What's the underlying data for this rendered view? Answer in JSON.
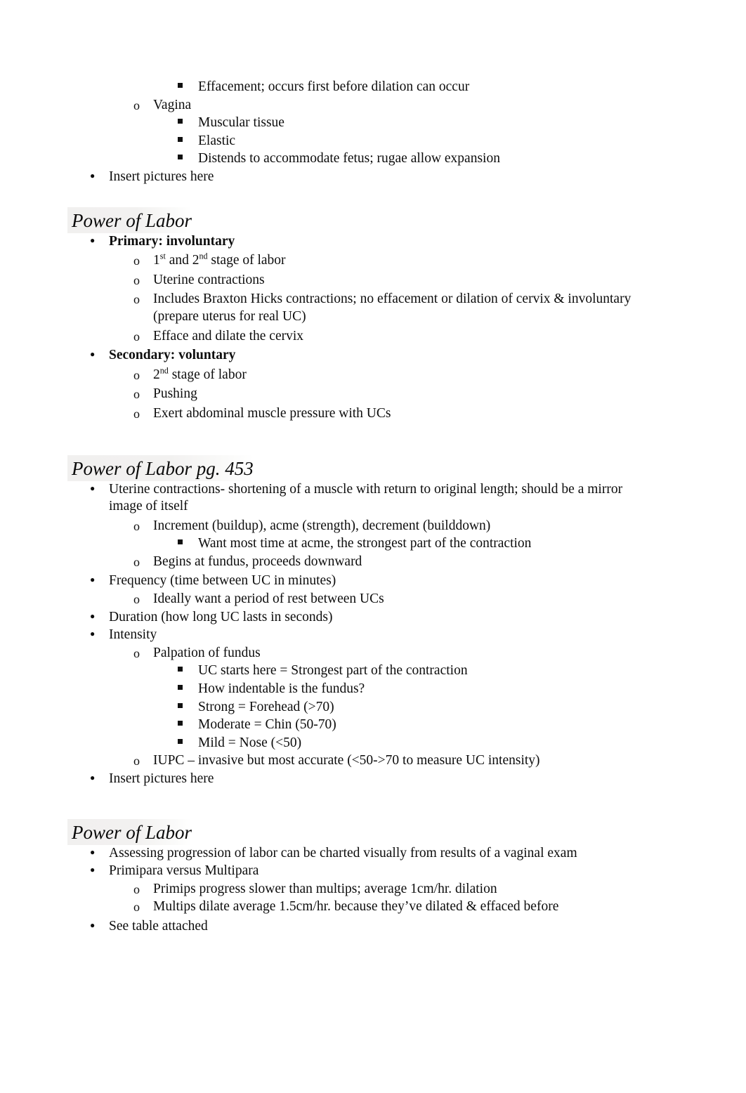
{
  "document": {
    "type": "lecture-notes",
    "text_color": "#0d0d0d",
    "heading_highlight_color": "#f1f0ef"
  },
  "blocks": {
    "top_list": {
      "items": [
        {
          "level": 3,
          "text": "Effacement; occurs first before dilation can occur"
        },
        {
          "level": 2,
          "text": "Vagina"
        },
        {
          "level": 3,
          "text": "Muscular tissue"
        },
        {
          "level": 3,
          "text": "Elastic"
        },
        {
          "level": 3,
          "text": "Distends to accommodate fetus; rugae allow expansion"
        },
        {
          "level": 1,
          "text": "Insert pictures here"
        }
      ]
    },
    "section1": {
      "heading": "Power of Labor",
      "items": [
        {
          "level": 1,
          "text": "Primary: involuntary",
          "bold": true
        },
        {
          "level": 2,
          "text_html": "1<sup>st</sup> and 2<sup>nd</sup> stage of labor",
          "text": "1st and 2nd stage of labor"
        },
        {
          "level": 2,
          "text": "Uterine contractions"
        },
        {
          "level": 2,
          "text": "Includes Braxton Hicks contractions; no effacement or dilation of cervix & involuntary (prepare uterus for real UC)"
        },
        {
          "level": 2,
          "text": "Efface and dilate the cervix"
        },
        {
          "level": 1,
          "text": "Secondary: voluntary",
          "bold": true
        },
        {
          "level": 2,
          "text_html": "2<sup>nd</sup> stage of labor",
          "text": "2nd stage of labor"
        },
        {
          "level": 2,
          "text": "Pushing"
        },
        {
          "level": 2,
          "text": "Exert abdominal muscle pressure with UCs"
        }
      ]
    },
    "section2": {
      "heading": "Power of Labor pg. 453",
      "items": [
        {
          "level": 1,
          "text": "Uterine contractions- shortening of a muscle with return to original length; should be a mirror image of itself"
        },
        {
          "level": 2,
          "text": "Increment (buildup), acme (strength), decrement (builddown)"
        },
        {
          "level": 3,
          "text": "Want most time at acme, the strongest part of the contraction"
        },
        {
          "level": 2,
          "text": "Begins at fundus, proceeds downward"
        },
        {
          "level": 1,
          "text": "Frequency (time between UC in minutes)"
        },
        {
          "level": 2,
          "text": "Ideally want a period of rest between UCs"
        },
        {
          "level": 1,
          "text": "Duration (how long UC lasts in seconds)"
        },
        {
          "level": 1,
          "text": "Intensity"
        },
        {
          "level": 2,
          "text": "Palpation of fundus"
        },
        {
          "level": 3,
          "text": "UC starts here = Strongest part of the contraction"
        },
        {
          "level": 3,
          "text": "How indentable is the fundus?"
        },
        {
          "level": 3,
          "text": "Strong = Forehead (>70)"
        },
        {
          "level": 3,
          "text": "Moderate = Chin (50-70)"
        },
        {
          "level": 3,
          "text": "Mild = Nose (<50)"
        },
        {
          "level": 2,
          "text": "IUPC – invasive but most accurate (<50->70 to measure UC intensity)"
        },
        {
          "level": 1,
          "text": "Insert pictures here"
        }
      ]
    },
    "section3": {
      "heading": "Power of Labor",
      "items": [
        {
          "level": 1,
          "text": "Assessing progression of labor can be charted visually from results of a vaginal exam"
        },
        {
          "level": 1,
          "text": "Primipara versus Multipara"
        },
        {
          "level": 2,
          "text": "Primips progress slower than multips; average 1cm/hr. dilation"
        },
        {
          "level": 2,
          "text": "Multips dilate average 1.5cm/hr. because they’ve dilated & efface"
        },
        {
          "level": 1,
          "text": "See table attached"
        }
      ]
    }
  },
  "fixups": {
    "section3_item3_full": "Multips dilate average 1.5cm/hr. because they’ve dilated & effaced before"
  }
}
